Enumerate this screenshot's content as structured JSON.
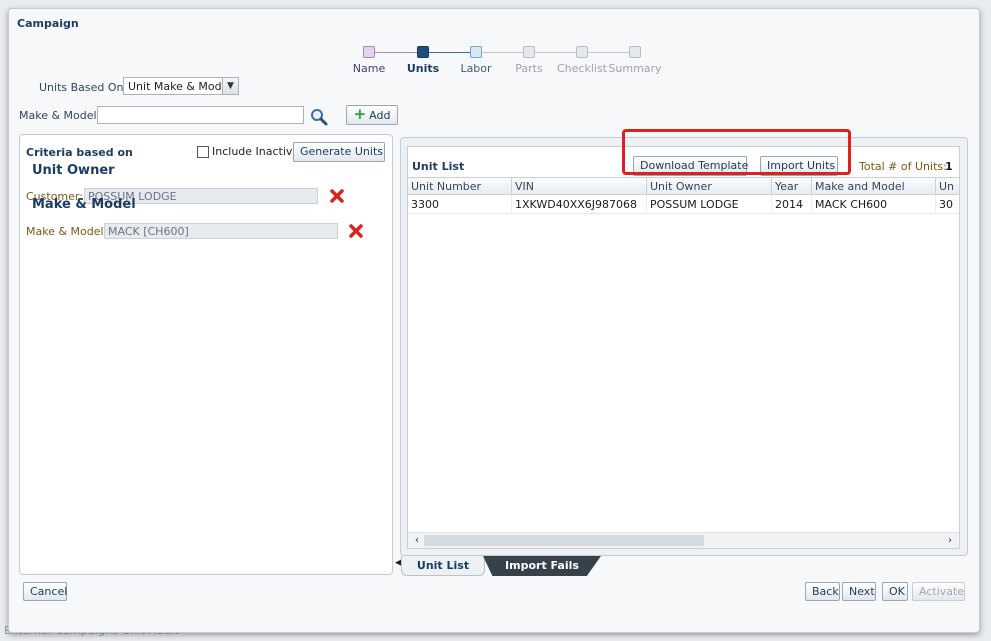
{
  "dialog": {
    "title": "Campaign"
  },
  "train": {
    "steps": [
      {
        "label": "Name",
        "state": "visited"
      },
      {
        "label": "Units",
        "state": "current"
      },
      {
        "label": "Labor",
        "state": "next"
      },
      {
        "label": "Parts",
        "state": "future"
      },
      {
        "label": "Checklist",
        "state": "future"
      },
      {
        "label": "Summary",
        "state": "future"
      }
    ]
  },
  "form": {
    "units_based_on_label": "Units Based On:",
    "units_based_on_value": "Unit Make & Model",
    "make_model_label": "Make & Model:",
    "make_model_value": "",
    "add_label": "Add"
  },
  "criteria": {
    "heading": "Criteria based on",
    "include_inactive_label": "Include Inactive",
    "generate_label": "Generate Units",
    "unit_owner_heading": "Unit Owner",
    "customer_label": "Customer:",
    "customer_value": "POSSUM LODGE",
    "make_model_heading": "Make & Model",
    "make_model_label": "Make & Model:",
    "make_model_value": "MACK [CH600]"
  },
  "unit_list": {
    "title": "Unit List",
    "download_label": "Download Template",
    "import_label": "Import Units",
    "total_label": "Total # of Units:",
    "total_value": "1",
    "columns": [
      "Unit Number",
      "VIN",
      "Unit Owner",
      "Year",
      "Make and Model",
      "Un"
    ],
    "rows": [
      [
        "3300",
        "1XKWD40XX6J987068",
        "POSSUM LODGE",
        "2014",
        "MACK CH600",
        "30"
      ]
    ]
  },
  "tabs": {
    "unit_list": "Unit List",
    "import_fails": "Import Fails"
  },
  "footer": {
    "cancel": "Cancel",
    "back": "Back",
    "next": "Next",
    "ok": "OK",
    "activate": "Activate"
  },
  "background": {
    "edge_text": "External Campaigns     Unit Audit"
  },
  "colors": {
    "highlight": "#e0201d",
    "header_text": "#1b3d63",
    "add_plus": "#23a33a",
    "delete_x": "#d9261c"
  }
}
